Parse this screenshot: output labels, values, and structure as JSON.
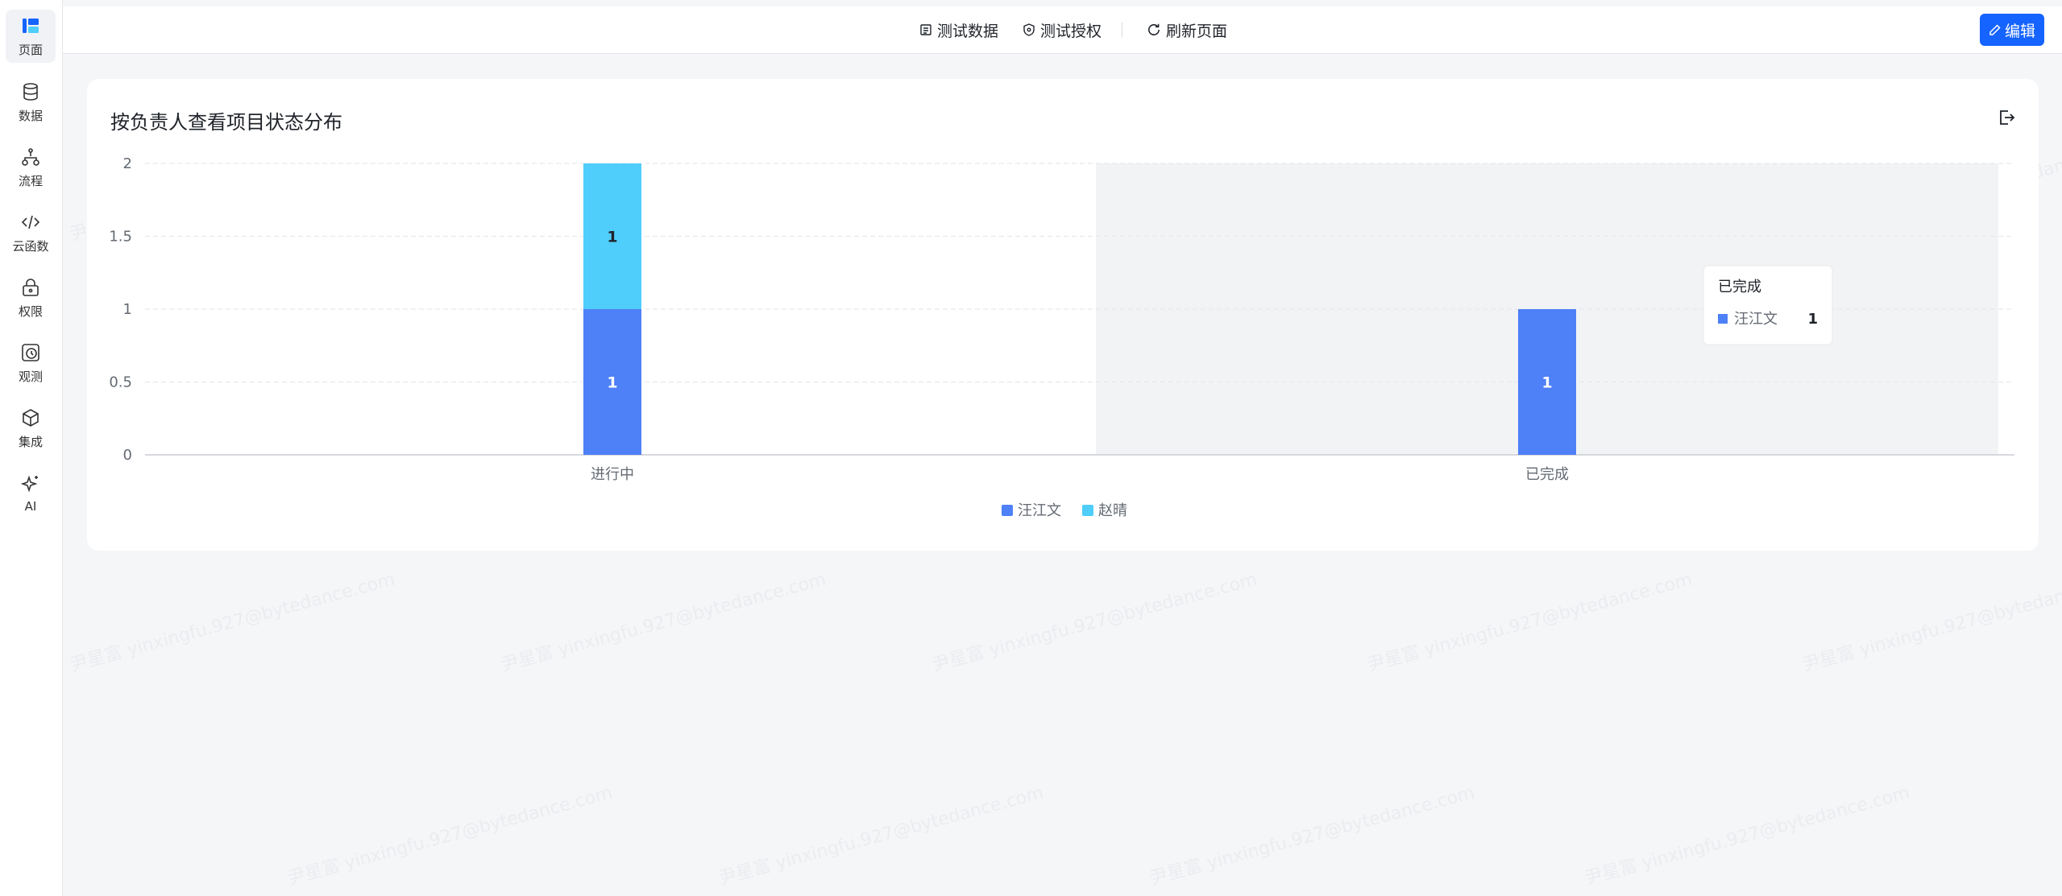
{
  "sidebar": {
    "items": [
      {
        "label": "页面",
        "icon": "layout-icon"
      },
      {
        "label": "数据",
        "icon": "database-icon"
      },
      {
        "label": "流程",
        "icon": "flow-icon"
      },
      {
        "label": "云函数",
        "icon": "code-icon"
      },
      {
        "label": "权限",
        "icon": "lock-icon"
      },
      {
        "label": "观测",
        "icon": "monitor-icon"
      },
      {
        "label": "集成",
        "icon": "cube-icon"
      },
      {
        "label": "AI",
        "icon": "sparkle-icon"
      }
    ]
  },
  "toolbar": {
    "test_data": "测试数据",
    "test_auth": "测试授权",
    "refresh": "刷新页面",
    "edit": "编辑"
  },
  "card": {
    "title": "按负责人查看项目状态分布"
  },
  "colors": {
    "series1": "#4e80f7",
    "series2": "#4fcdfb",
    "accent": "#1664ff"
  },
  "chart_data": {
    "type": "bar",
    "stacked": true,
    "categories": [
      "进行中",
      "已完成"
    ],
    "series": [
      {
        "name": "汪江文",
        "values": [
          1,
          1
        ]
      },
      {
        "name": "赵晴",
        "values": [
          1,
          0
        ]
      }
    ],
    "ylim": [
      0,
      2
    ],
    "yticks": [
      "2",
      "1.5",
      "1",
      "0.5",
      "0"
    ],
    "legend_position": "bottom-center",
    "grid": true,
    "tooltip": {
      "title": "已完成",
      "series": "汪江文",
      "value": "1"
    }
  },
  "watermark": "尹星富 yinxingfu.927@bytedance.com"
}
